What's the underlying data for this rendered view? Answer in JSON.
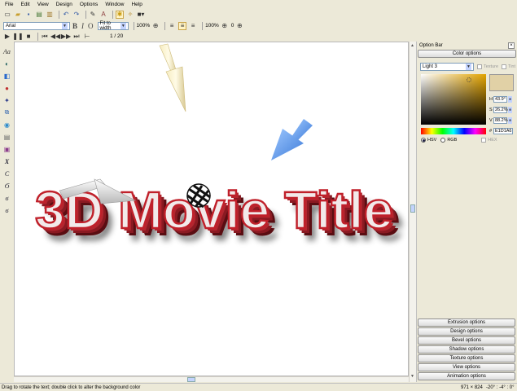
{
  "menu": [
    "File",
    "Edit",
    "View",
    "Design",
    "Options",
    "Window",
    "Help"
  ],
  "toolbar": {
    "font_name": "Arial",
    "fit_mode": "Fit to width",
    "zoom_1": "100%",
    "zoom_2": "100%",
    "zoom_3_value": "0",
    "frame_counter": "1 / 20",
    "bold": "B",
    "italic": "I",
    "outline": "O"
  },
  "canvas": {
    "title_text": "3D Movie Title"
  },
  "left_tools": {
    "text_tool": "Aa"
  },
  "panel": {
    "title": "Option Bar",
    "close": "×",
    "active_section": "Color options",
    "light_select": "Light 3",
    "texture_label": "Texture",
    "tint_label": "Tint",
    "h_label": "H",
    "h_value": "43.9°",
    "s_label": "S",
    "s_value": "26.2%",
    "v_label": "V",
    "v_value": "88.2%",
    "hash_label": "#",
    "hex_value": "E1D1A6",
    "mode_hsv": "HSV",
    "mode_rgb": "RGB",
    "mode_hex": "HEX",
    "current_color": "#e1d1a6",
    "sections": [
      "Extrusion options",
      "Design options",
      "Bevel options",
      "Shadow options",
      "Texture options",
      "View options",
      "Animation options"
    ]
  },
  "status": {
    "hint": "Drag to rotate the text; double click to alter the background color",
    "dimensions": "971 × 824",
    "angles": "-20° : -4° : 0°"
  }
}
